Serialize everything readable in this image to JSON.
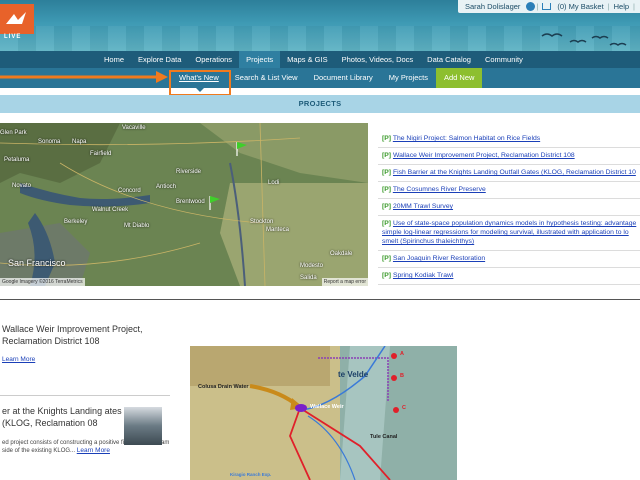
{
  "header": {
    "logo_text": "LIVE",
    "user_name": "Sarah Dolislager",
    "basket_label": "(0) My Basket",
    "help_label": "Help"
  },
  "main_nav": [
    "Home",
    "Explore Data",
    "Operations",
    "Projects",
    "Maps & GIS",
    "Photos, Videos, Docs",
    "Data Catalog",
    "Community"
  ],
  "main_nav_active": "Projects",
  "sub_nav": [
    "What's New",
    "Search & List View",
    "Document Library",
    "My Projects",
    "Add New"
  ],
  "projects_title": "PROJECTS",
  "map": {
    "labels": [
      "Glen Park",
      "Sonoma",
      "Napa",
      "Vacaville",
      "Petaluma",
      "Fairfield",
      "Novato",
      "Concord",
      "Antioch",
      "Brentwood",
      "Walnut Creek",
      "Berkeley",
      "Mt Diablo",
      "San Francisco",
      "Stockton",
      "Lodi",
      "Manteca",
      "Modesto",
      "Oakdale",
      "Salida",
      "Riverside"
    ],
    "credit": "Google Imagery ©2016 TerraMetrics",
    "terms": "Report a map error"
  },
  "project_list": [
    {
      "tag": "[P]",
      "title": "The Nigiri Project: Salmon Habitat on Rice Fields"
    },
    {
      "tag": "[P]",
      "title": "Wallace Weir Improvement Project, Reclamation District 108"
    },
    {
      "tag": "[P]",
      "title": "Fish Barrier at the Knights Landing Outfall Gates (KLOG, Reclamation District 10"
    },
    {
      "tag": "[P]",
      "title": "The Cosumnes River Preserve"
    },
    {
      "tag": "[P]",
      "title": "20MM Trawl Survey"
    },
    {
      "tag": "[P]",
      "title": "Use of state-space population dynamics models in hypothesis testing: advantage simple log-linear regressions for modeling survival, illustrated with application to lo smelt (Spirinchus thaleichthys)"
    },
    {
      "tag": "[P]",
      "title": "San Joaquin River Restoration"
    },
    {
      "tag": "[P]",
      "title": "Spring Kodiak Trawl"
    }
  ],
  "news": [
    {
      "title": "Wallace Weir Improvement Project, Reclamation District 108",
      "learn_more": "Learn More"
    },
    {
      "title": "er at the Knights Landing ates (KLOG, Reclamation 08",
      "desc": "ed project consists of constructing a positive fish barrier stream side of the existing KLOG...",
      "learn_more": "Learn More"
    }
  ],
  "figure": {
    "labels": [
      "Colusa Drain Water",
      "Wallace Weir",
      "te Velde",
      "Tule Canal",
      "A",
      "B",
      "C",
      "Kiragio Ranch Exp."
    ]
  },
  "colors": {
    "nav_bg": "#1e5c7a",
    "subnav_bg": "#2a7597",
    "add_new_bg": "#8dbf2f",
    "highlight": "#f07a1e",
    "link": "#1a3fb8",
    "tag_green": "#3a9a2a"
  },
  "icons": [
    "bird-logo-icon",
    "gear-icon",
    "basket-icon",
    "flag-icon",
    "arrow-icon"
  ]
}
